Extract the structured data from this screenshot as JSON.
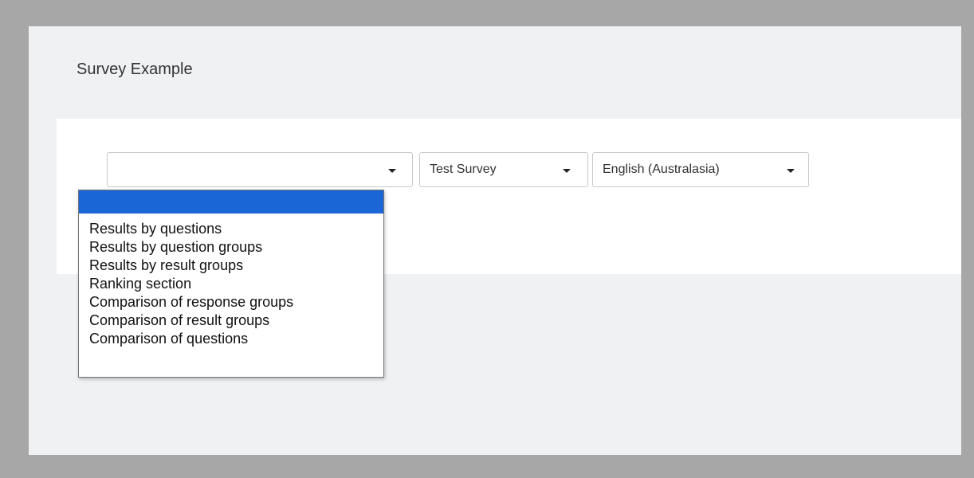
{
  "page": {
    "title": "Survey Example"
  },
  "filters": {
    "report_type": {
      "value": "",
      "options": [
        "",
        "Results by questions",
        "Results by question groups",
        "Results by result groups",
        "Ranking section",
        "Comparison of response groups",
        "Comparison of result groups",
        "Comparison of questions"
      ]
    },
    "survey": {
      "value": "Test Survey"
    },
    "language": {
      "value": "English (Australasia)"
    }
  },
  "colors": {
    "selected_option": "#1a66d6",
    "page_background": "#f0f1f3",
    "frame": "#a7a7a7"
  },
  "icons": {
    "caret": "chevron-down-icon"
  }
}
